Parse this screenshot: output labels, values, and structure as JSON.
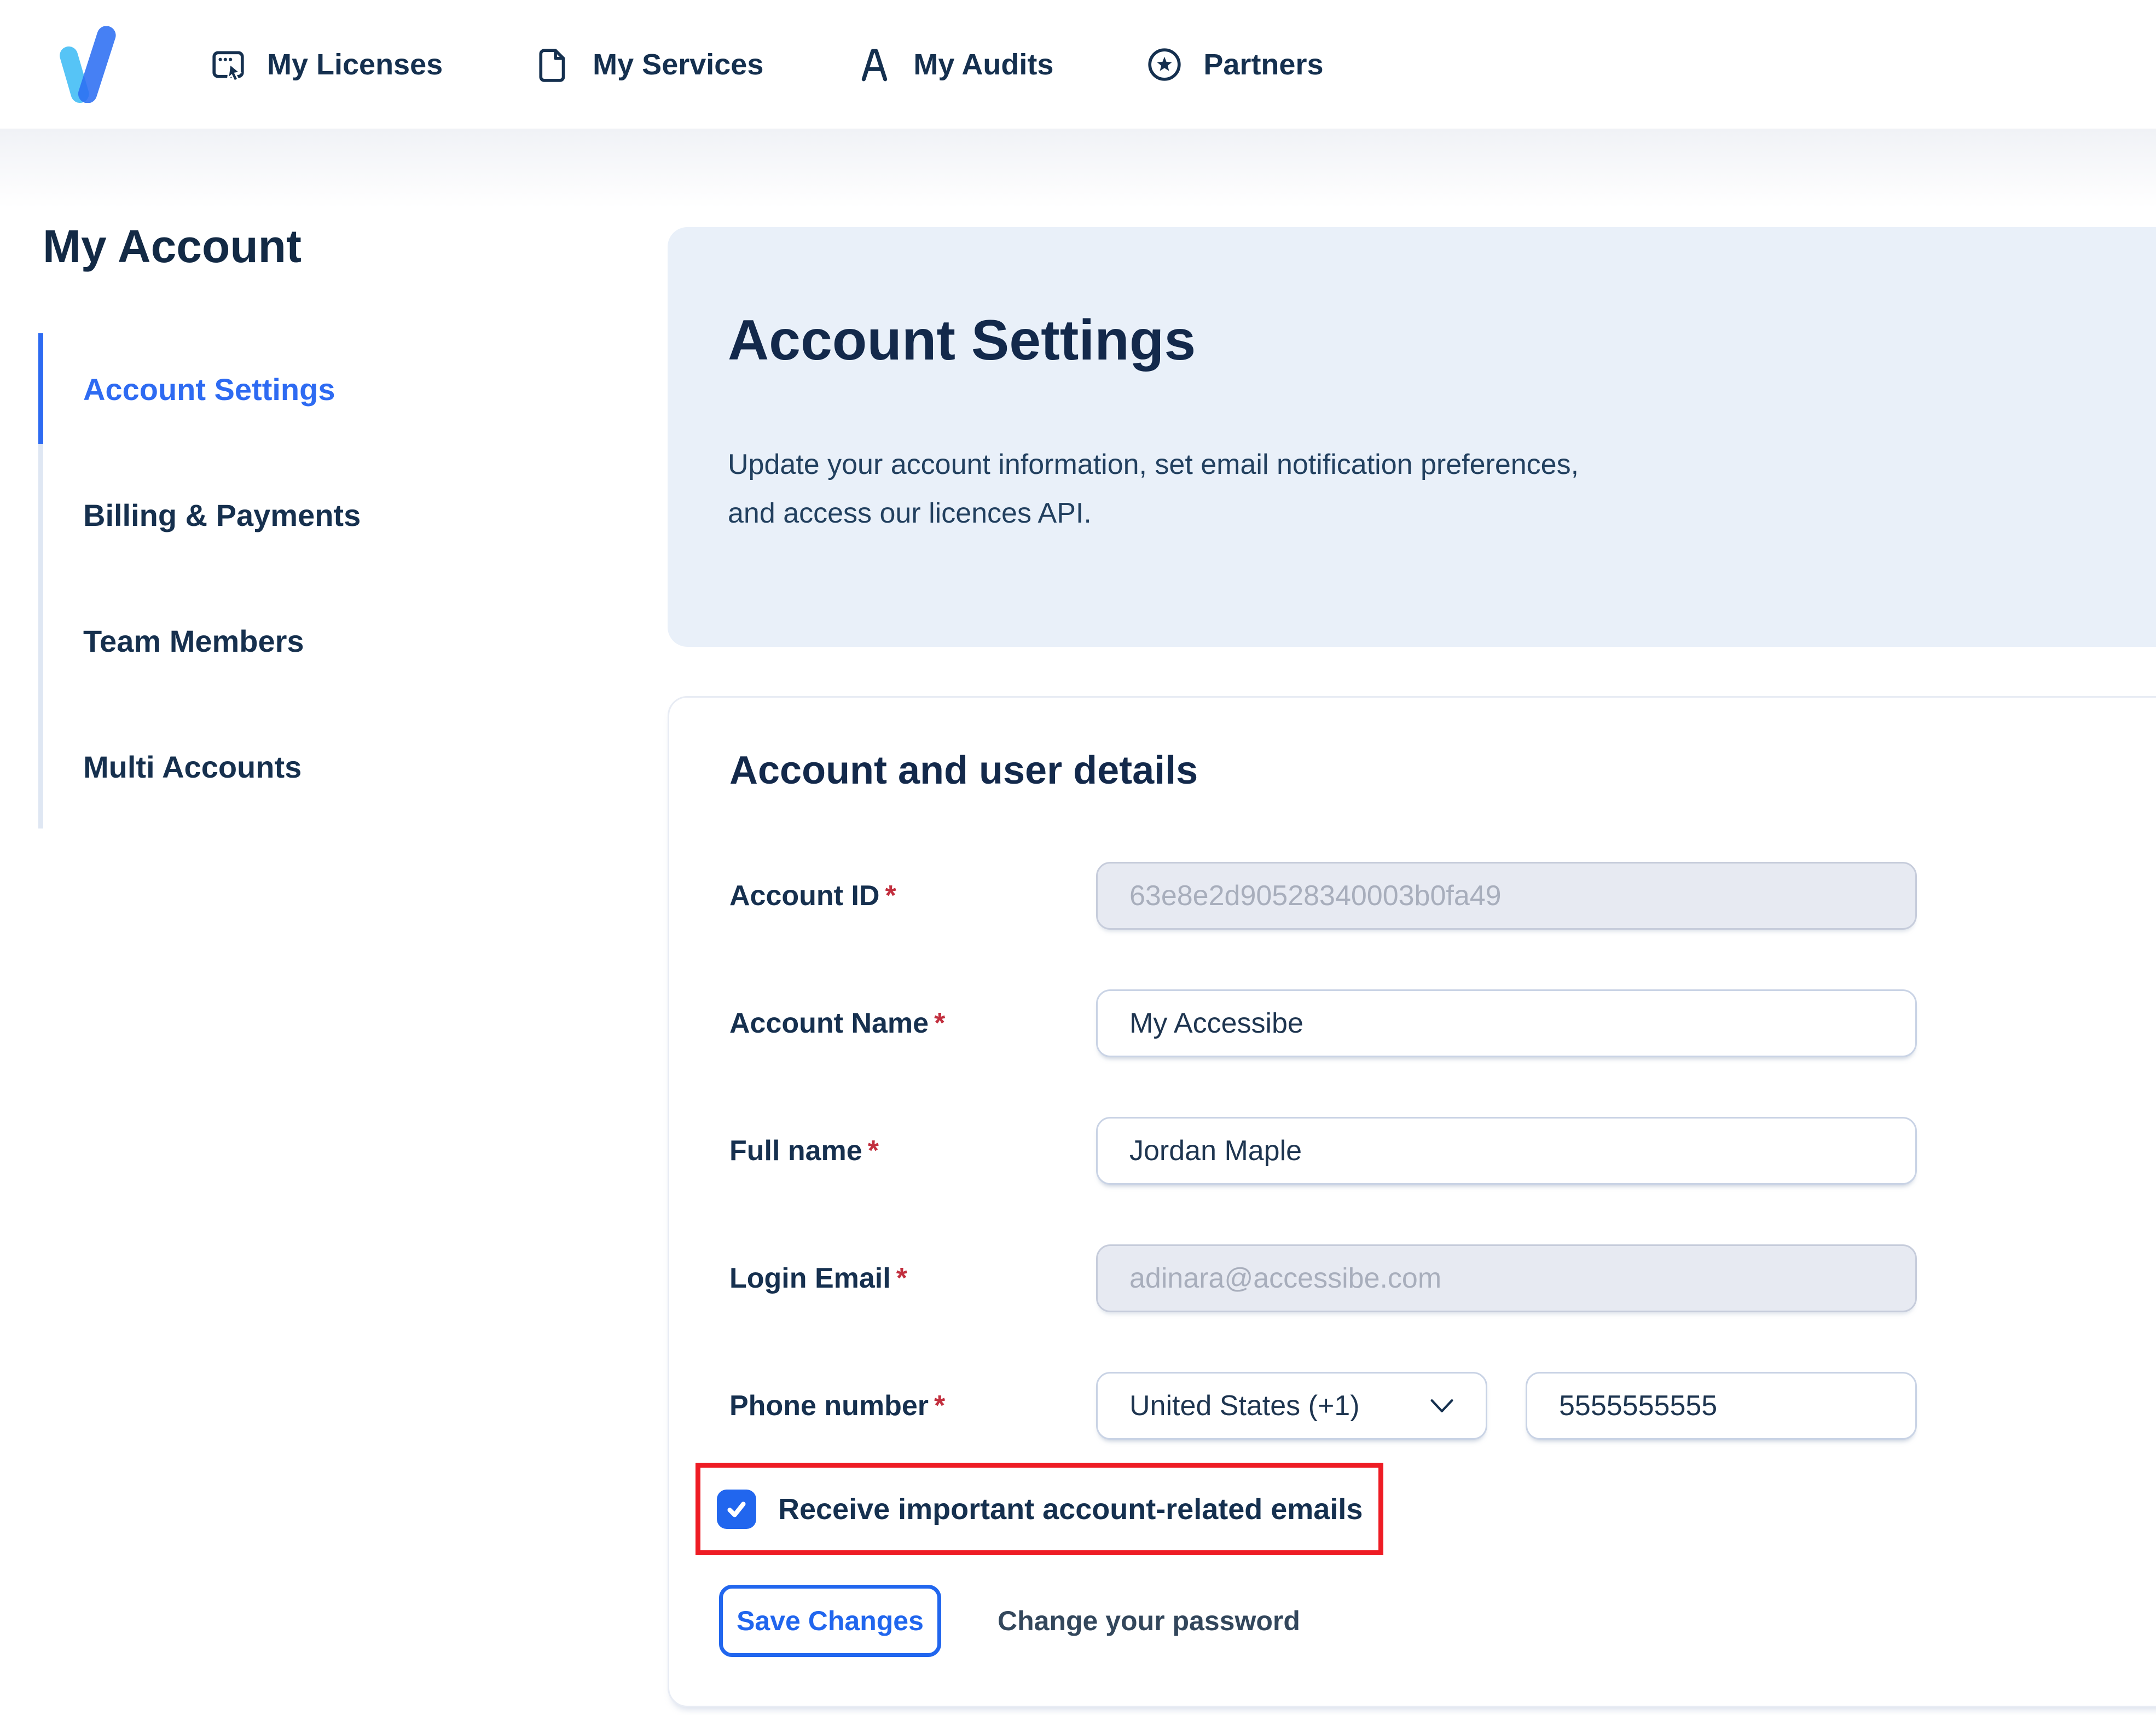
{
  "nav": {
    "items": [
      {
        "label": "My Licenses",
        "icon": "licenses-icon"
      },
      {
        "label": "My Services",
        "icon": "services-icon"
      },
      {
        "label": "My Audits",
        "icon": "audits-icon"
      },
      {
        "label": "Partners",
        "icon": "partners-icon"
      }
    ]
  },
  "sidebar": {
    "title": "My Account",
    "items": [
      {
        "label": "Account Settings",
        "active": true
      },
      {
        "label": "Billing & Payments",
        "active": false
      },
      {
        "label": "Team Members",
        "active": false
      },
      {
        "label": "Multi Accounts",
        "active": false
      }
    ]
  },
  "hero": {
    "title": "Account Settings",
    "description_line1": "Update your account information, set email notification preferences,",
    "description_line2": "and access our licences API."
  },
  "form": {
    "title": "Account and user details",
    "required_marker": "*",
    "fields": [
      {
        "label": "Account ID",
        "value": "63e8e2d90528340003b0fa49",
        "disabled": true
      },
      {
        "label": "Account Name",
        "value": "My Accessibe",
        "disabled": false
      },
      {
        "label": "Full name",
        "value": "Jordan Maple",
        "disabled": false
      },
      {
        "label": "Login Email",
        "value": "adinara@accessibe.com",
        "disabled": true
      },
      {
        "label": "Phone number",
        "country": "United States (+1)",
        "value": "5555555555",
        "disabled": false
      }
    ],
    "checkbox": {
      "checked": true,
      "label": "Receive important account-related emails"
    },
    "save_label": "Save Changes",
    "change_password_label": "Change your password"
  },
  "colors": {
    "navy_text": "#15304f",
    "accent_blue": "#2166ee",
    "sidebar_active_blue": "#2e6bf2",
    "hero_card_blue": "#e9f0f9",
    "annotation_red": "#ee1c24",
    "required_red": "#c22f3e",
    "disabled_input_bg": "#e7eaf2",
    "disabled_input_text": "#a8aebc",
    "logo_light_blue": "#56c4f6",
    "logo_dark_blue": "#2d6ff3"
  }
}
